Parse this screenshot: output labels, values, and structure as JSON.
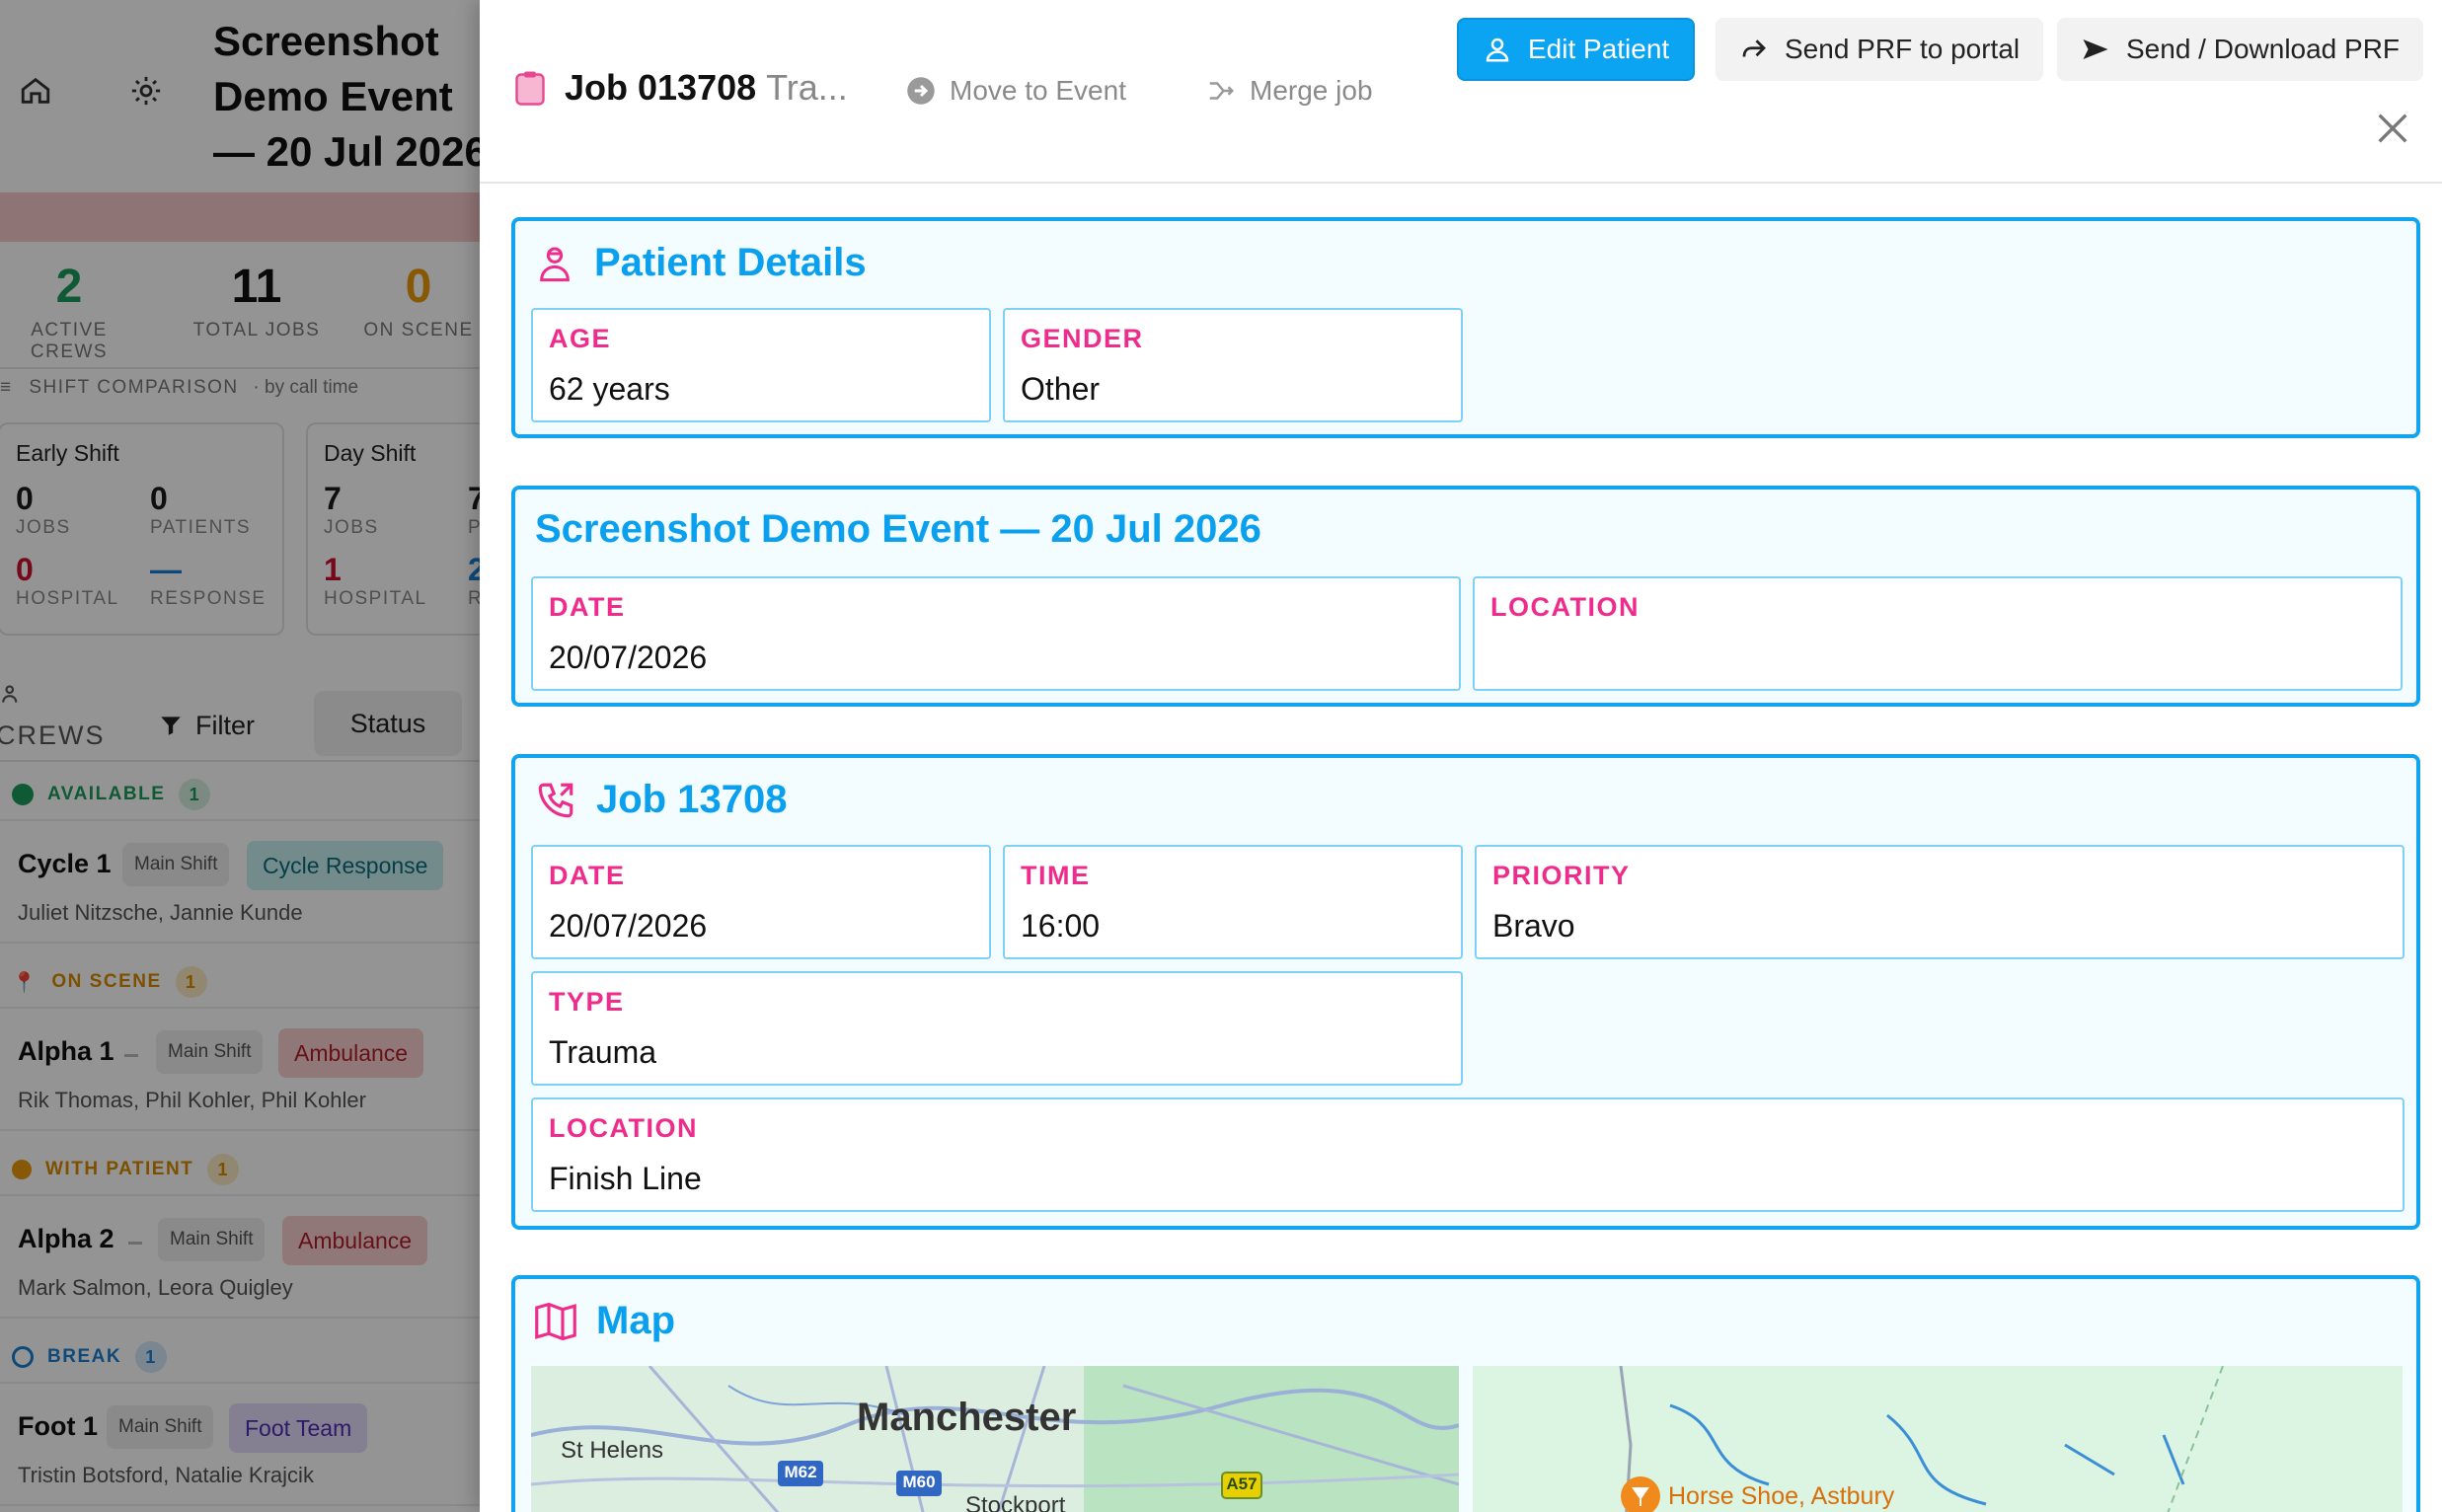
{
  "background": {
    "event_title": "Screenshot Demo Event — 20 Jul 2026",
    "stats": [
      {
        "value": "2",
        "label": "ACTIVE CREWS",
        "color": "#1a9a5c"
      },
      {
        "value": "11",
        "label": "TOTAL JOBS",
        "color": "#111111"
      },
      {
        "value": "0",
        "label": "ON SCENE",
        "color": "#e89a0c"
      }
    ],
    "shift_comparison": {
      "label": "SHIFT COMPARISON",
      "sub": "· by call time"
    },
    "shifts": [
      {
        "name": "Early Shift",
        "jobs": "0",
        "jobs_label": "JOBS",
        "patients": "0",
        "patients_label": "PATIENTS",
        "hospital": "0",
        "hospital_label": "HOSPITAL",
        "response": "—",
        "response_label": "RESPONSE"
      },
      {
        "name": "Day Shift",
        "jobs": "7",
        "jobs_label": "JOBS",
        "patients": "7",
        "patients_label": "P",
        "hospital": "1",
        "hospital_label": "HOSPITAL",
        "response": "2",
        "response_label": "R"
      }
    ],
    "crews_label": "CREWS",
    "filter_label": "Filter",
    "status_label": "Status",
    "groups": [
      {
        "label": "AVAILABLE",
        "count": "1",
        "color": "#1a9a5c"
      },
      {
        "label": "ON SCENE",
        "count": "1",
        "color": "#e89a0c"
      },
      {
        "label": "WITH PATIENT",
        "count": "1",
        "color": "#e89a0c"
      },
      {
        "label": "BREAK",
        "count": "1",
        "color": "#1a7fd0"
      }
    ],
    "crews": [
      {
        "name": "Cycle 1",
        "shift": "Main Shift",
        "type": "Cycle Response",
        "members": "Juliet Nitzsche, Jannie Kunde"
      },
      {
        "name": "Alpha 1",
        "shift": "Main Shift",
        "type": "Ambulance",
        "members": "Rik Thomas, Phil Kohler, Phil Kohler"
      },
      {
        "name": "Alpha 2",
        "shift": "Main Shift",
        "type": "Ambulance",
        "members": "Mark Salmon, Leora Quigley"
      },
      {
        "name": "Foot 1",
        "shift": "Main Shift",
        "type": "Foot Team",
        "members": "Tristin Botsford, Natalie Krajcik"
      }
    ]
  },
  "drawer": {
    "job_title": "Job 013708",
    "job_subtitle": "Tra...",
    "move_to_event": "Move to Event",
    "merge_job": "Merge job",
    "edit_patient": "Edit Patient",
    "send_prf_portal": "Send PRF to portal",
    "send_download_prf": "Send / Download PRF"
  },
  "patient": {
    "title": "Patient Details",
    "age_label": "AGE",
    "age": "62 years",
    "gender_label": "GENDER",
    "gender": "Other"
  },
  "event": {
    "title": "Screenshot Demo Event — 20 Jul 2026",
    "date_label": "DATE",
    "date": "20/07/2026",
    "location_label": "LOCATION",
    "location": ""
  },
  "job": {
    "title": "Job 13708",
    "date_label": "DATE",
    "date": "20/07/2026",
    "time_label": "TIME",
    "time": "16:00",
    "priority_label": "PRIORITY",
    "priority": "Bravo",
    "type_label": "TYPE",
    "type": "Trauma",
    "location_label": "LOCATION",
    "location": "Finish Line"
  },
  "map": {
    "title": "Map",
    "city": "Manchester",
    "town1": "St Helens",
    "town2": "Stockport",
    "road1": "M62",
    "road2": "M60",
    "road3": "A57",
    "poi": "Horse Shoe, Astbury"
  },
  "colors": {
    "accent": "#0aa4f2",
    "label_pink": "#ee2c8b",
    "section_border": "#12a4ef"
  }
}
